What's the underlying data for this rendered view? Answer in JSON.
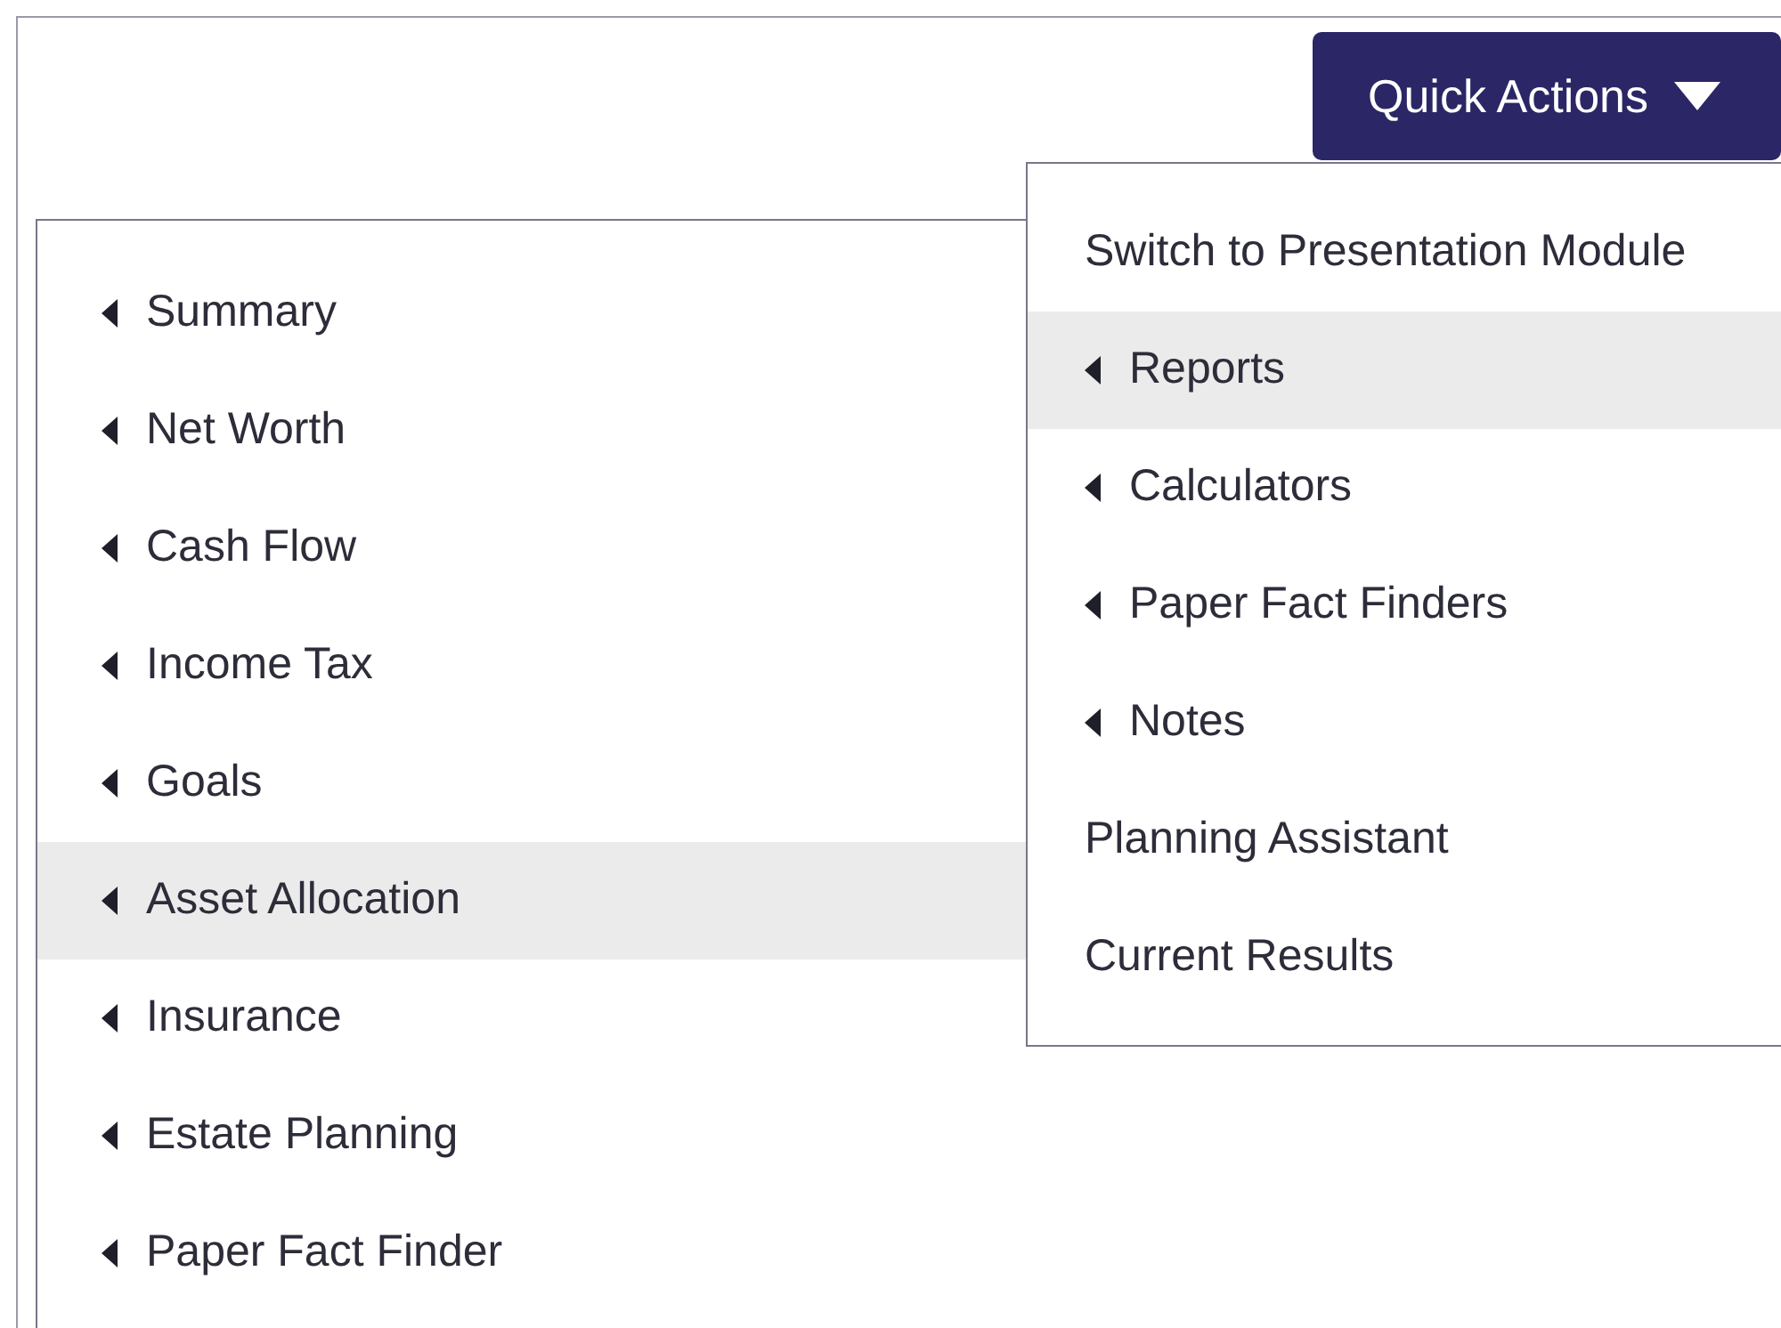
{
  "quick_actions_button": {
    "label": "Quick Actions"
  },
  "quick_actions_menu": [
    {
      "label": "Switch to Presentation Module",
      "kind": "action",
      "selected": false
    },
    {
      "label": "Reports",
      "kind": "submenu",
      "selected": true
    },
    {
      "label": "Calculators",
      "kind": "submenu",
      "selected": false
    },
    {
      "label": "Paper Fact Finders",
      "kind": "submenu",
      "selected": false
    },
    {
      "label": "Notes",
      "kind": "submenu",
      "selected": false
    },
    {
      "label": "Planning Assistant",
      "kind": "action",
      "selected": false
    },
    {
      "label": "Current Results",
      "kind": "action",
      "selected": false
    }
  ],
  "reports_submenu": [
    {
      "label": "Summary",
      "kind": "submenu",
      "selected": false
    },
    {
      "label": "Net Worth",
      "kind": "submenu",
      "selected": false
    },
    {
      "label": "Cash Flow",
      "kind": "submenu",
      "selected": false
    },
    {
      "label": "Income Tax",
      "kind": "submenu",
      "selected": false
    },
    {
      "label": "Goals",
      "kind": "submenu",
      "selected": false
    },
    {
      "label": "Asset Allocation",
      "kind": "submenu",
      "selected": true
    },
    {
      "label": "Insurance",
      "kind": "submenu",
      "selected": false
    },
    {
      "label": "Estate Planning",
      "kind": "submenu",
      "selected": false
    },
    {
      "label": "Paper Fact Finder",
      "kind": "submenu",
      "selected": false
    }
  ]
}
